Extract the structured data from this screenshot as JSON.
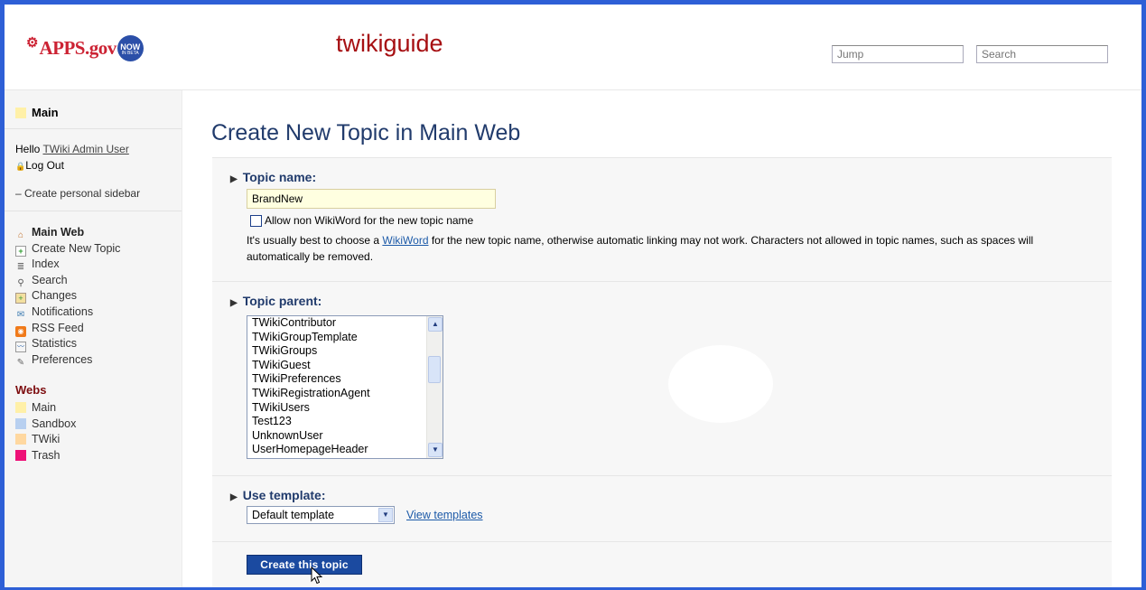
{
  "header": {
    "logo_apps": "APPS.gov",
    "logo_now": "NOW",
    "logo_beta": "IN BETA",
    "site_title": "twikiguide",
    "jump_placeholder": "Jump",
    "search_placeholder": "Search"
  },
  "sidebar": {
    "web_name": "Main",
    "hello_prefix": "Hello ",
    "user_name": "TWiki Admin User",
    "logout": "Log Out",
    "personal_sidebar": "– Create personal sidebar",
    "nav": [
      {
        "label": "Main Web",
        "icon": "home-icon"
      },
      {
        "label": "Create New Topic",
        "icon": "new-topic-icon"
      },
      {
        "label": "Index",
        "icon": "index-icon"
      },
      {
        "label": "Search",
        "icon": "search-icon"
      },
      {
        "label": "Changes",
        "icon": "changes-icon"
      },
      {
        "label": "Notifications",
        "icon": "notifications-icon"
      },
      {
        "label": "RSS Feed",
        "icon": "rss-icon"
      },
      {
        "label": "Statistics",
        "icon": "statistics-icon"
      },
      {
        "label": "Preferences",
        "icon": "preferences-icon"
      }
    ],
    "webs_title": "Webs",
    "webs": [
      {
        "label": "Main",
        "color": "#fff0a8"
      },
      {
        "label": "Sandbox",
        "color": "#b8d0f0"
      },
      {
        "label": "TWiki",
        "color": "#ffd8a0"
      },
      {
        "label": "Trash",
        "color": "#ee1177"
      }
    ]
  },
  "main": {
    "page_title": "Create New Topic in Main Web",
    "topic_name": {
      "label": "Topic name:",
      "value": "BrandNew",
      "nonwiki_label": "Allow non WikiWord for the new topic name",
      "help_before": "It's usually best to choose a ",
      "help_link": "WikiWord",
      "help_after": " for the new topic name, otherwise automatic linking may not work. Characters not allowed in topic names, such as spaces will automatically be removed."
    },
    "topic_parent": {
      "label": "Topic parent:",
      "options": [
        "TWikiContributor",
        "TWikiGroupTemplate",
        "TWikiGroups",
        "TWikiGuest",
        "TWikiPreferences",
        "TWikiRegistrationAgent",
        "TWikiUsers",
        "Test123",
        "UnknownUser",
        "UserHomepageHeader"
      ]
    },
    "use_template": {
      "label": "Use template:",
      "selected": "Default template",
      "view_link": "View templates"
    },
    "create_button": "Create this topic"
  }
}
